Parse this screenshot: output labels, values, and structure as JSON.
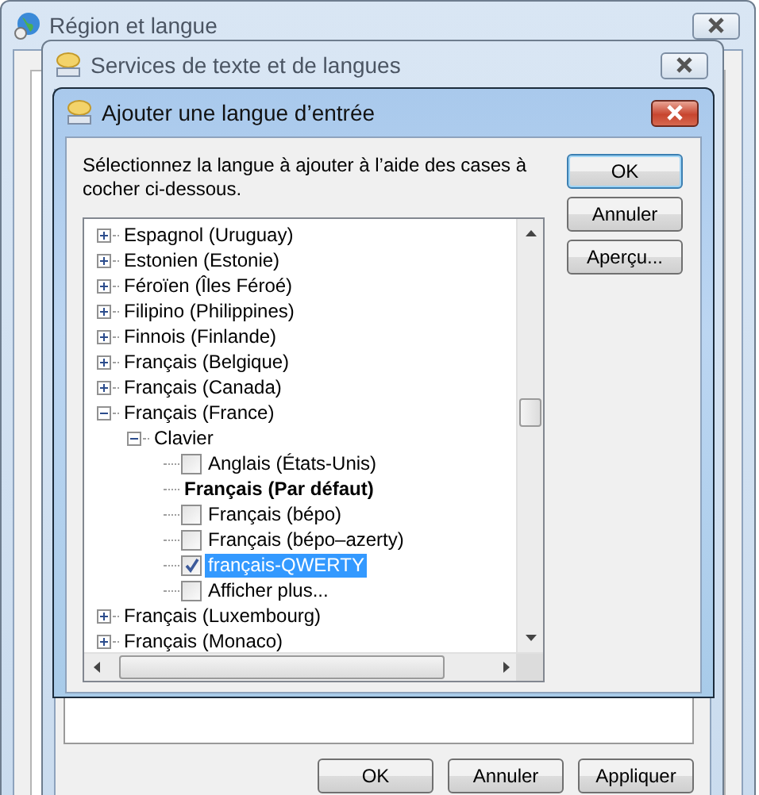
{
  "back_window": {
    "title": "Région et langue"
  },
  "services_window": {
    "title": "Services de texte et de langues",
    "buttons": [
      "OK",
      "Annuler",
      "Appliquer"
    ]
  },
  "dialog": {
    "title": "Ajouter une langue d’entrée",
    "instruction": "Sélectionnez la langue à ajouter à l’aide des cases à cocher ci-dessous.",
    "buttons": [
      "OK",
      "Annuler",
      "Aperçu..."
    ],
    "tree": [
      {
        "label": "Espagnol (Uruguay)",
        "expanded": false
      },
      {
        "label": "Estonien (Estonie)",
        "expanded": false
      },
      {
        "label": "Féroïen (Îles Féroé)",
        "expanded": false
      },
      {
        "label": "Filipino (Philippines)",
        "expanded": false
      },
      {
        "label": "Finnois (Finlande)",
        "expanded": false
      },
      {
        "label": "Français (Belgique)",
        "expanded": false
      },
      {
        "label": "Français (Canada)",
        "expanded": false
      },
      {
        "label": "Français (France)",
        "expanded": true,
        "children": [
          {
            "label": "Clavier",
            "expanded": true,
            "children": [
              {
                "kind": "checkbox",
                "label": "Anglais (États-Unis)",
                "checked": false,
                "selected": false
              },
              {
                "kind": "default",
                "label": "Français (Par défaut)"
              },
              {
                "kind": "checkbox",
                "label": "Français (bépo)",
                "checked": false,
                "selected": false
              },
              {
                "kind": "checkbox",
                "label": "Français (bépo–azerty)",
                "checked": false,
                "selected": false
              },
              {
                "kind": "checkbox",
                "label": "français-QWERTY",
                "checked": true,
                "selected": true
              },
              {
                "kind": "checkbox",
                "label": "Afficher plus...",
                "checked": false,
                "selected": false
              }
            ]
          }
        ]
      },
      {
        "label": "Français (Luxembourg)",
        "expanded": false
      },
      {
        "label": "Français (Monaco)",
        "expanded": false
      }
    ]
  }
}
